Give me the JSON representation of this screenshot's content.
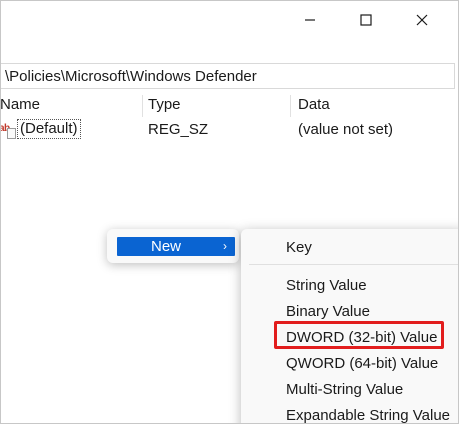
{
  "window": {
    "controls": {
      "minimize_icon": "minimize-icon",
      "maximize_icon": "maximize-icon",
      "close_icon": "close-icon"
    }
  },
  "address_bar": {
    "path": "\\Policies\\Microsoft\\Windows Defender"
  },
  "list": {
    "columns": [
      "Name",
      "Type",
      "Data"
    ],
    "rows": [
      {
        "icon": "string-value-icon",
        "name": "(Default)",
        "type": "REG_SZ",
        "data": "(value not set)"
      }
    ]
  },
  "context_menu": {
    "new_label": "New",
    "chevron": "›",
    "selected_color": "#0a64d2"
  },
  "submenu": {
    "items": [
      "Key",
      "String Value",
      "Binary Value",
      "DWORD (32-bit) Value",
      "QWORD (64-bit) Value",
      "Multi-String Value",
      "Expandable String Value"
    ],
    "highlighted_item": "DWORD (32-bit) Value",
    "highlight_color": "#e21d1d"
  }
}
